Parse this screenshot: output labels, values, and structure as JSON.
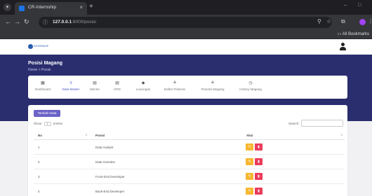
{
  "browser": {
    "tab_title": "CR-Internship",
    "url_host": "127.0.0.1",
    "url_path": ":8000/posisi",
    "bookmarks_label": "All Bookmarks",
    "icons": [
      "menu-icon",
      "close-icon",
      "plus-icon",
      "back-icon",
      "forward-icon",
      "reload-icon",
      "site-info-icon",
      "key-icon",
      "star-icon",
      "extensions-icon",
      "profile-icon",
      "kebab-icon",
      "folder-icon"
    ]
  },
  "app": {
    "logo_text": "INTERNSHIP",
    "page_title": "Posisi Magang",
    "breadcrumb": "Home  >  Posisi",
    "menu": [
      {
        "icon": "▦",
        "label": "Dashboard",
        "active": false
      },
      {
        "icon": "≡",
        "label": "Data Master",
        "active": true
      },
      {
        "icon": "▤",
        "label": "Mentor",
        "active": false
      },
      {
        "icon": "▤",
        "label": "HRD",
        "active": false
      },
      {
        "icon": "◆",
        "label": "Lowongan",
        "active": false
      },
      {
        "icon": "≗",
        "label": "Daftar Pelamar",
        "active": false
      },
      {
        "icon": "≗",
        "label": "Peserta Magang",
        "active": false
      },
      {
        "icon": "◷",
        "label": "History Magang",
        "active": false
      }
    ],
    "colors": {
      "header": "#2a2d6e",
      "accent": "#6b63c6",
      "edit": "#f7b731",
      "delete": "#eb3b5a"
    }
  },
  "table": {
    "add_button": "Tambah Data",
    "show_label": "Show",
    "show_value": "4",
    "entries_label": "entries",
    "search_label": "Search:",
    "columns": [
      "No",
      "Posisi",
      "Aksi"
    ],
    "rows": [
      {
        "no": "1",
        "posisi": "Data Analyst"
      },
      {
        "no": "2",
        "posisi": "Data Scientist"
      },
      {
        "no": "3",
        "posisi": "Front-End Developer"
      },
      {
        "no": "4",
        "posisi": "Back-End Developer"
      }
    ]
  }
}
